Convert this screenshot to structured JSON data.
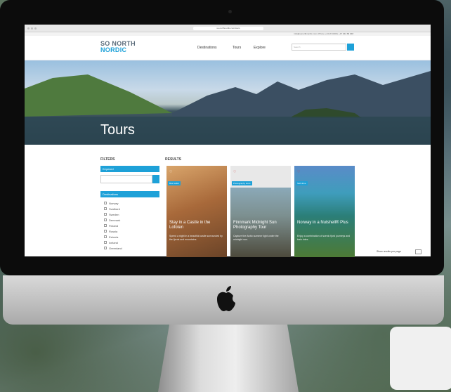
{
  "browser": {
    "url": "so-northnordic.com/tours"
  },
  "topbar": {
    "text": "info@sonorthnordic.com  |  Phone +44 20 3409  |  +47 944 89 948"
  },
  "nav": {
    "brand_line1": "SO NORTH",
    "brand_line2": "NORDIC",
    "links": [
      "Destinations",
      "Tours",
      "Explore"
    ],
    "search_placeholder": "Search"
  },
  "hero": {
    "title": "Tours"
  },
  "filters": {
    "heading": "FILTERS",
    "keyword_label": "Keyword",
    "destination_label": "Destinations",
    "countries": [
      "Norway",
      "Svalbard",
      "Sweden",
      "Denmark",
      "Finland",
      "Russia",
      "Estonia",
      "Iceland",
      "Greenland"
    ]
  },
  "results": {
    "heading": "RESULTS",
    "cards": [
      {
        "tag": "Best seller",
        "title": "Stay in a Castle in the Lofoten",
        "desc": "Spend a night in a beautiful castle surrounded by the fjords and mountains."
      },
      {
        "tag": "Photography tours",
        "title": "Finnmark Midnight Sun Photography Tour",
        "desc": "Capture the Arctic summer light under the midnight sun."
      },
      {
        "tag": "Self drive",
        "title": "Norway in a Nutshell® Plus",
        "desc": "Enjoy a combination of scenic fjord journeys and train rides."
      }
    ]
  },
  "sort": {
    "label": "Show results per page"
  }
}
